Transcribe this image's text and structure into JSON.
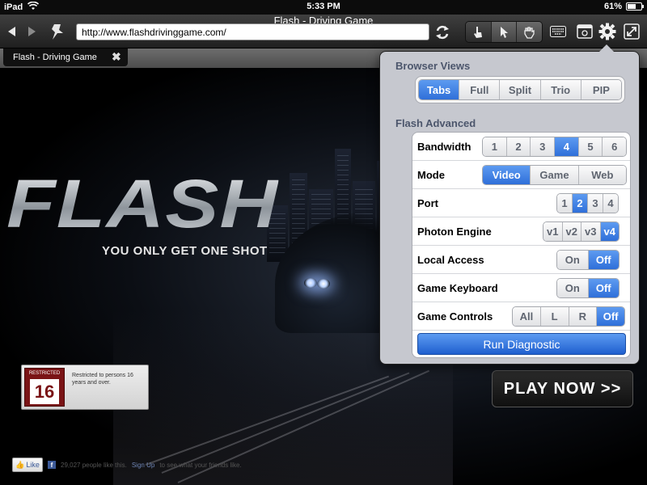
{
  "status_bar": {
    "device": "iPad",
    "time": "5:33 PM",
    "battery": "61%",
    "battery_level": 0.61
  },
  "toolbar": {
    "page_title": "Flash - Driving Game",
    "url": "http://www.flashdrivinggame.com/",
    "interaction_modes": [
      "touch-hand-icon",
      "pointer-arrow-icon",
      "grab-hand-icon"
    ],
    "active_mode": "touch-hand-icon"
  },
  "tabs": [
    {
      "label": "Flash - Driving Game"
    }
  ],
  "page": {
    "logo": "FLASH",
    "tagline": "YOU ONLY GET ONE SHOT",
    "rating": {
      "label": "RESTRICTED",
      "number": "16",
      "text": "Restricted to persons 16 years and over."
    },
    "play_button": "PLAY NOW >>",
    "like": {
      "button": "Like",
      "count_text": "29,027 people like this.",
      "signup": "Sign Up",
      "suffix": "to see what your friends like."
    }
  },
  "popover": {
    "browser_views_title": "Browser Views",
    "browser_views": [
      "Tabs",
      "Full",
      "Split",
      "Trio",
      "PIP"
    ],
    "browser_views_selected": "Tabs",
    "flash_advanced_title": "Flash Advanced",
    "rows": [
      {
        "label": "Bandwidth",
        "options": [
          "1",
          "2",
          "3",
          "4",
          "5",
          "6"
        ],
        "selected": "4"
      },
      {
        "label": "Mode",
        "options": [
          "Video",
          "Game",
          "Web"
        ],
        "selected": "Video"
      },
      {
        "label": "Port",
        "options": [
          "1",
          "2",
          "3",
          "4"
        ],
        "selected": "2"
      },
      {
        "label": "Photon Engine",
        "options": [
          "v1",
          "v2",
          "v3",
          "v4"
        ],
        "selected": "v4"
      },
      {
        "label": "Local Access",
        "options": [
          "On",
          "Off"
        ],
        "selected": "Off"
      },
      {
        "label": "Game Keyboard",
        "options": [
          "On",
          "Off"
        ],
        "selected": "Off"
      },
      {
        "label": "Game Controls",
        "options": [
          "All",
          "L",
          "R",
          "Off"
        ],
        "selected": "Off"
      }
    ],
    "diagnostic_button": "Run Diagnostic"
  },
  "colors": {
    "selected_blue": "#2f6fd9",
    "section_title": "#4c566c",
    "rating_red": "#7a1416"
  }
}
